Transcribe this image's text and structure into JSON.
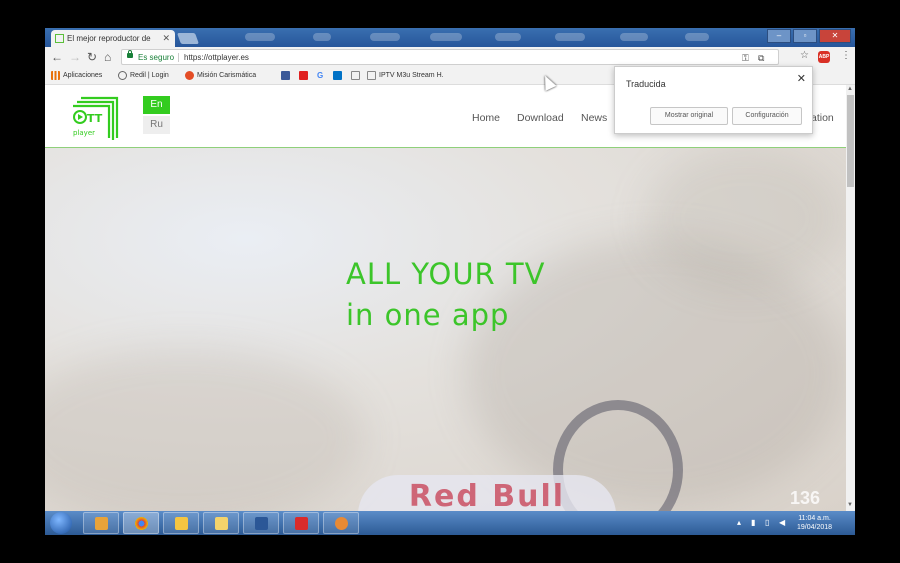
{
  "browser": {
    "tab_title": "El mejor reproductor de",
    "tab_close": "✕",
    "address": {
      "secure_label": "Es seguro",
      "url": "https://ottplayer.es"
    },
    "bookmarks": [
      {
        "label": "Aplicaciones",
        "icon": "apps-grid-icon",
        "color": "#e8710a"
      },
      {
        "label": "Redil | Login",
        "icon": "world-icon",
        "color": "#666666"
      },
      {
        "label": "Misión Carismática",
        "icon": "joomla-icon",
        "color": "#e44d26"
      },
      {
        "label": "",
        "icon": "facebook-icon",
        "color": "#3b5998"
      },
      {
        "label": "",
        "icon": "red-logo-icon",
        "color": "#e02020"
      },
      {
        "label": "G",
        "icon": "google-icon",
        "color": "#4285f4"
      },
      {
        "label": "",
        "icon": "outlook-icon",
        "color": "#0072c6"
      },
      {
        "label": "",
        "icon": "page-icon",
        "color": "#888888"
      },
      {
        "label": "IPTV M3u Stream H.",
        "icon": "page-icon",
        "color": "#888888"
      }
    ]
  },
  "site": {
    "lang": {
      "en": "En",
      "ru": "Ru"
    },
    "nav": [
      "Home",
      "Download",
      "News",
      "ation"
    ],
    "hero": {
      "line1": "ALL YOUR TV",
      "line2": "in one app"
    },
    "logo": {
      "brand_color": "#33cc1f"
    },
    "video_counter": "136"
  },
  "translate_popup": {
    "title": "Traducida",
    "close": "✕",
    "show_original": "Mostrar original",
    "settings": "Configuración"
  },
  "taskbar": {
    "time": "11:04 a.m.",
    "date": "19/04/2018",
    "apps": [
      {
        "name": "media-player-icon",
        "color": "#e8a33a"
      },
      {
        "name": "chrome-icon",
        "color": "#4caf50"
      },
      {
        "name": "explorer-icon",
        "color": "#f4c542"
      },
      {
        "name": "folder-icon",
        "color": "#f3d36b"
      },
      {
        "name": "word-icon",
        "color": "#2b5797"
      },
      {
        "name": "iptv-icon",
        "color": "#d92b2b"
      },
      {
        "name": "app-icon",
        "color": "#e88a35"
      }
    ]
  }
}
